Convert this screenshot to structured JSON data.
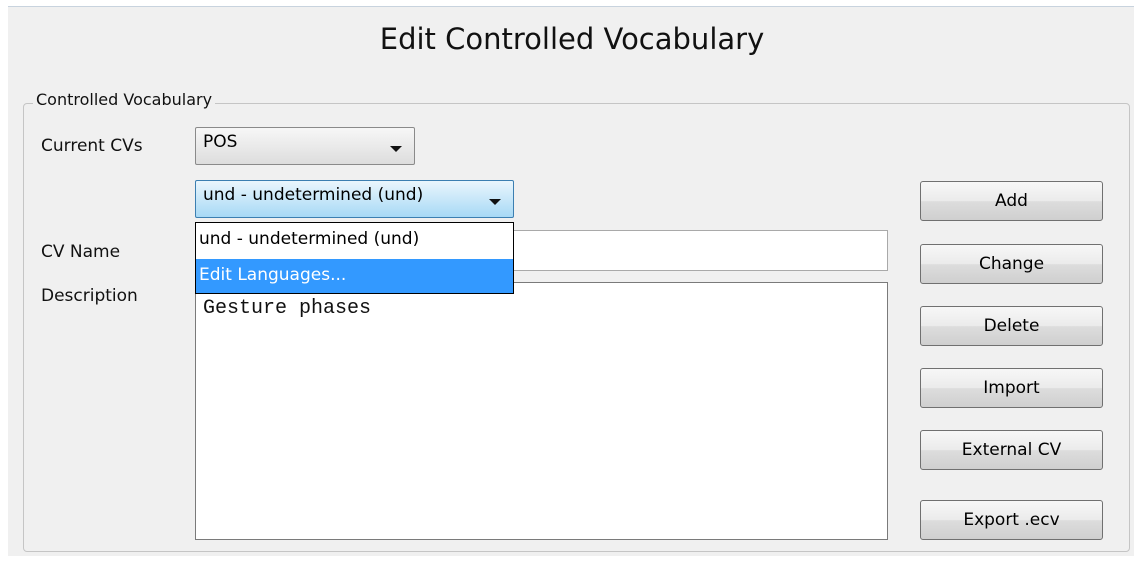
{
  "dialog": {
    "title": "Edit Controlled Vocabulary"
  },
  "group": {
    "legend": "Controlled Vocabulary"
  },
  "form": {
    "current_cvs_label": "Current CVs",
    "current_cvs_value": "POS",
    "language_value": "und - undetermined (und)",
    "cv_name_label": "CV Name",
    "cv_name_value": "",
    "description_label": "Description",
    "description_value": "Gesture phases"
  },
  "language_dropdown": {
    "options": [
      {
        "label": "und - undetermined (und)",
        "selected": false
      },
      {
        "label": "Edit Languages...",
        "selected": true
      }
    ]
  },
  "buttons": {
    "add": "Add",
    "change": "Change",
    "delete": "Delete",
    "import": "Import",
    "external_cv": "External CV",
    "export_ecv": "Export .ecv"
  },
  "icons": {
    "combo_arrow": "chevron-down-icon"
  },
  "colors": {
    "highlight": "#3399ff",
    "dialog_bg": "#f0f0f0"
  }
}
